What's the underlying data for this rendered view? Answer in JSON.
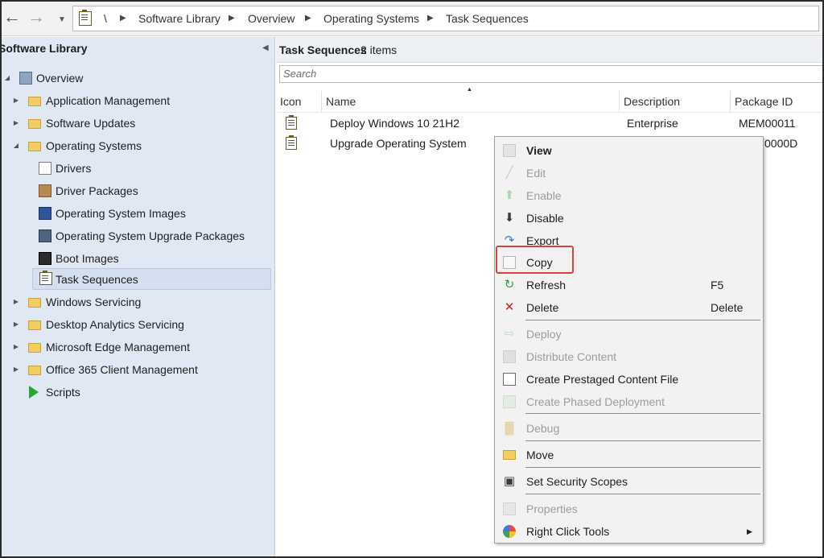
{
  "breadcrumb": {
    "root": "\\",
    "items": [
      "Software Library",
      "Overview",
      "Operating Systems",
      "Task Sequences"
    ]
  },
  "nav": {
    "title": "Software Library",
    "overview": "Overview",
    "items": [
      {
        "label": "Application Management"
      },
      {
        "label": "Software Updates"
      },
      {
        "label": "Operating Systems"
      },
      {
        "label": "Drivers"
      },
      {
        "label": "Driver Packages"
      },
      {
        "label": "Operating System Images"
      },
      {
        "label": "Operating System Upgrade Packages"
      },
      {
        "label": "Boot Images"
      },
      {
        "label": "Task Sequences"
      },
      {
        "label": "Windows Servicing"
      },
      {
        "label": "Desktop Analytics Servicing"
      },
      {
        "label": "Microsoft Edge Management"
      },
      {
        "label": "Office 365 Client Management"
      },
      {
        "label": "Scripts"
      }
    ]
  },
  "main": {
    "title": "Task Sequences",
    "count": "2 items",
    "search_placeholder": "Search",
    "columns": [
      "Icon",
      "Name",
      "Description",
      "Package ID"
    ],
    "rows": [
      {
        "name": "Deploy Windows 10 21H2",
        "description": "Enterprise",
        "package_id": "MEM00011"
      },
      {
        "name": "Upgrade Operating System",
        "description": "",
        "package_id": "0000D"
      }
    ]
  },
  "context_menu": {
    "items": [
      {
        "label": "View",
        "shortcut": "",
        "icon": "view-icon"
      },
      {
        "label": "Edit",
        "shortcut": "",
        "icon": "edit-icon"
      },
      {
        "label": "Enable",
        "shortcut": "",
        "icon": "enable-icon"
      },
      {
        "label": "Disable",
        "shortcut": "",
        "icon": "disable-icon"
      },
      {
        "label": "Export",
        "shortcut": "",
        "icon": "export-icon"
      },
      {
        "label": "Copy",
        "shortcut": "",
        "icon": "copy-icon"
      },
      {
        "label": "Refresh",
        "shortcut": "F5",
        "icon": "refresh-icon"
      },
      {
        "label": "Delete",
        "shortcut": "Delete",
        "icon": "delete-icon"
      },
      {
        "label": "Deploy",
        "shortcut": "",
        "icon": "deploy-icon"
      },
      {
        "label": "Distribute Content",
        "shortcut": "",
        "icon": "distribute-icon"
      },
      {
        "label": "Create Prestaged Content File",
        "shortcut": "",
        "icon": "prestaged-icon"
      },
      {
        "label": "Create Phased Deployment",
        "shortcut": "",
        "icon": "phased-icon"
      },
      {
        "label": "Debug",
        "shortcut": "",
        "icon": "debug-icon"
      },
      {
        "label": "Move",
        "shortcut": "",
        "icon": "move-icon"
      },
      {
        "label": "Set Security Scopes",
        "shortcut": "",
        "icon": "lock-icon"
      },
      {
        "label": "Properties",
        "shortcut": "",
        "icon": "properties-icon"
      },
      {
        "label": "Right Click Tools",
        "shortcut": "",
        "icon": "right-click-tools-icon"
      }
    ]
  },
  "colors": {
    "nav_bg": "#dfe8f3",
    "highlight_box": "#d9433a",
    "menu_bg": "#f2f2f2"
  }
}
